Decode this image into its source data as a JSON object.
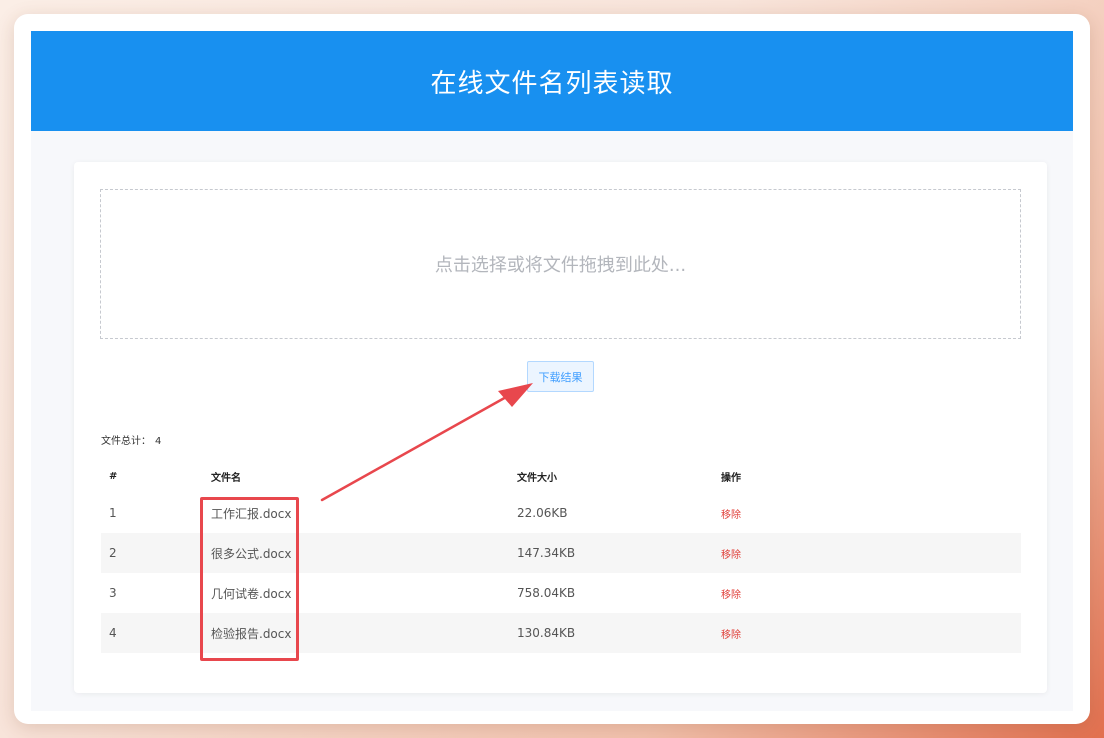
{
  "header": {
    "title": "在线文件名列表读取"
  },
  "dropzone": {
    "text": "点击选择或将文件拖拽到此处..."
  },
  "download_button": {
    "label": "下载结果"
  },
  "summary": {
    "label": "文件总计：",
    "count": "4"
  },
  "table": {
    "columns": [
      "#",
      "文件名",
      "文件大小",
      "操作"
    ],
    "rows": [
      {
        "index": "1",
        "name": "工作汇报.docx",
        "size": "22.06KB",
        "action": "移除"
      },
      {
        "index": "2",
        "name": "很多公式.docx",
        "size": "147.34KB",
        "action": "移除"
      },
      {
        "index": "3",
        "name": "几何试卷.docx",
        "size": "758.04KB",
        "action": "移除"
      },
      {
        "index": "4",
        "name": "检验报告.docx",
        "size": "130.84KB",
        "action": "移除"
      }
    ]
  },
  "colors": {
    "header_bg": "#1890f0",
    "annotation_red": "#e8474d",
    "remove_red": "#e0403a",
    "button_blue": "#409eff"
  }
}
